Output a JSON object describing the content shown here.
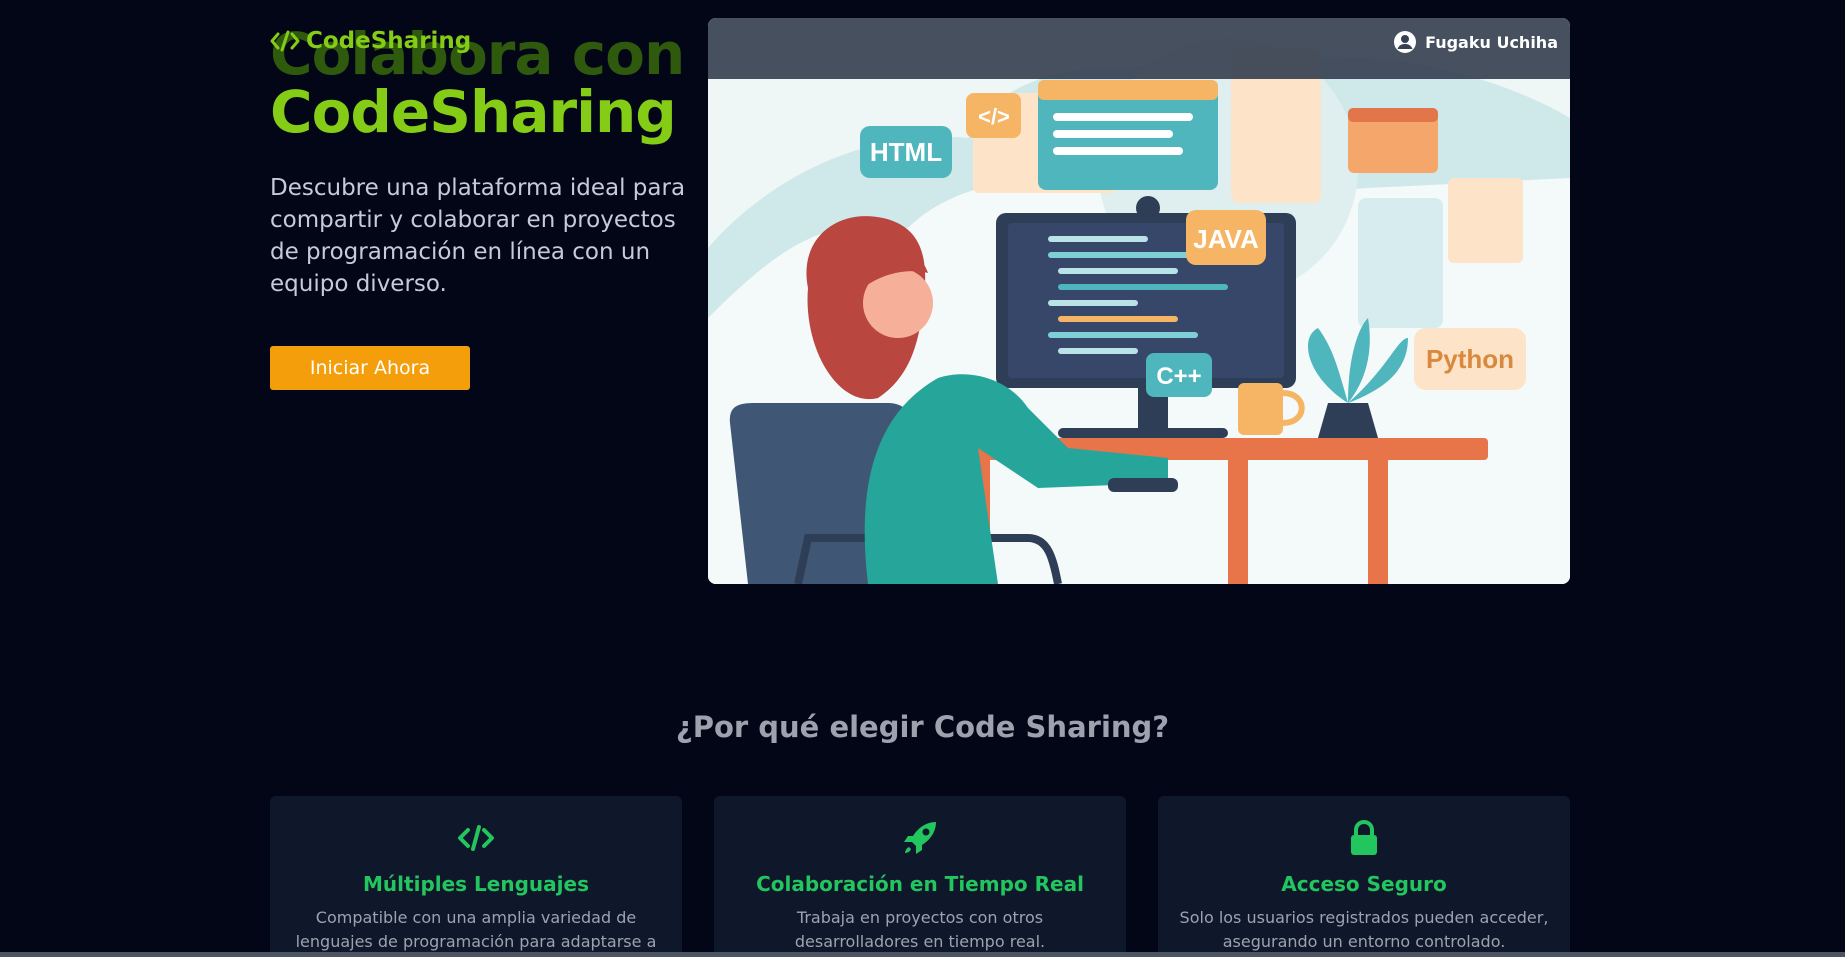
{
  "header": {
    "brand": "CodeSharing",
    "user_name": "Fugaku Uchiha"
  },
  "hero": {
    "ghost_title": "Colabora con",
    "title": "CodeSharing",
    "subtitle": "Descubre una plataforma ideal para compartir y colaborar en proyectos de programación en línea con un equipo diverso.",
    "cta_label": "Iniciar Ahora",
    "image_tags": [
      "HTML",
      "</>",
      "JAVA",
      "C++",
      "Python"
    ]
  },
  "why": {
    "title": "¿Por qué elegir Code Sharing?",
    "features": [
      {
        "icon": "code-icon",
        "title": "Múltiples Lenguajes",
        "description": "Compatible con una amplia variedad de lenguajes de programación para adaptarse a tus necesidades."
      },
      {
        "icon": "rocket-icon",
        "title": "Colaboración en Tiempo Real",
        "description": "Trabaja en proyectos con otros desarrolladores en tiempo real."
      },
      {
        "icon": "lock-icon",
        "title": "Acceso Seguro",
        "description": "Solo los usuarios registrados pueden acceder, asegurando un entorno controlado."
      }
    ]
  },
  "colors": {
    "background": "#030617",
    "brand_green": "#84cc16",
    "accent_orange": "#f59e0b",
    "feature_green": "#22c55e",
    "card_bg": "#0f172a"
  }
}
